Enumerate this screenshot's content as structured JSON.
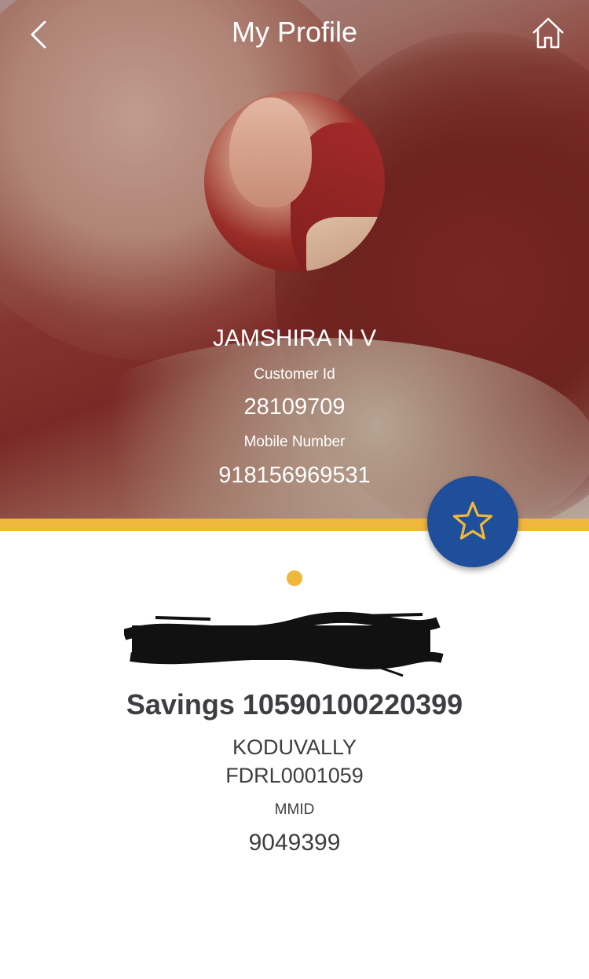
{
  "header": {
    "title": "My Profile",
    "back_icon": "chevron-left-icon",
    "home_icon": "home-icon"
  },
  "profile": {
    "name": "JAMSHIRA N V",
    "customer_id_label": "Customer Id",
    "customer_id": "28109709",
    "mobile_label": "Mobile Number",
    "mobile": "918156969531"
  },
  "favorite": {
    "icon": "star-icon"
  },
  "account": {
    "title": "Savings 10590100220399",
    "branch": "KODUVALLY",
    "ifsc": "FDRL0001059",
    "mmid_label": "MMID",
    "mmid": "9049399"
  },
  "colors": {
    "accent": "#f0b83a",
    "primary": "#1f4e9a",
    "text_dark": "#3e3e42"
  }
}
